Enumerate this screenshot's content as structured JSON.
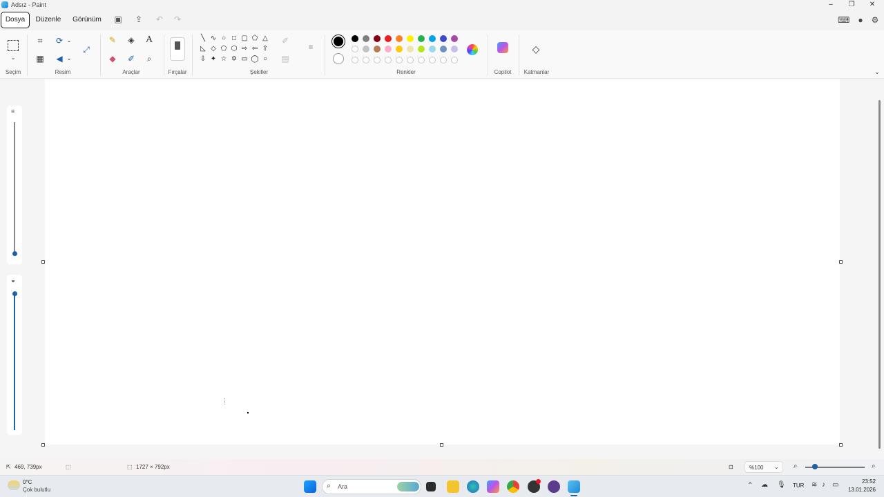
{
  "window": {
    "title": "Adsız - Paint"
  },
  "menu": {
    "file": "Dosya",
    "edit": "Düzenle",
    "view": "Görünüm"
  },
  "ribbon": {
    "groups": {
      "selection": "Seçim",
      "image": "Resim",
      "tools": "Araçlar",
      "brushes": "Fırçalar",
      "shapes": "Şekiller",
      "colors": "Renkler",
      "copilot": "Copilot",
      "layers": "Katmanlar"
    },
    "palette_row1": [
      "#000000",
      "#7f7f7f",
      "#880015",
      "#ed1c24",
      "#ff7f27",
      "#fff200",
      "#22b14c",
      "#00a2e8",
      "#3f48cc",
      "#a349a4"
    ],
    "palette_row2": [
      "#ffffff",
      "#c3c3c3",
      "#b97a57",
      "#ffaec9",
      "#ffc90e",
      "#efe4b0",
      "#b5e61d",
      "#99d9ea",
      "#7092be",
      "#c8bfe7"
    ],
    "primary_color": "#000000",
    "secondary_color": "#ffffff"
  },
  "status": {
    "cursor_position": "469, 739px",
    "canvas_size": "1727 × 792px",
    "zoom": "%100"
  },
  "taskbar": {
    "weather_temp": "0°C",
    "weather_desc": "Çok bulutlu",
    "search_placeholder": "Ara",
    "language": "TUR",
    "time": "23:52",
    "date": "13.01.2026"
  }
}
